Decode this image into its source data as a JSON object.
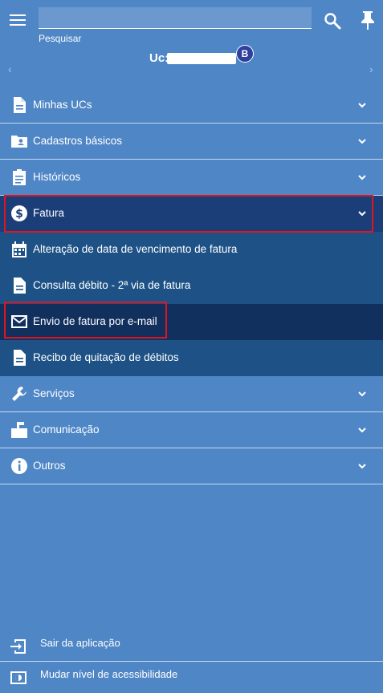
{
  "header": {
    "search_value": "",
    "search_label": "Pesquisar",
    "uc_label": "Uc:",
    "uc_badge": "B",
    "prev_arrow": "‹",
    "next_arrow": "›",
    "icons": [
      "menu-icon",
      "search-icon",
      "pin-icon"
    ]
  },
  "menu": {
    "items": [
      {
        "label": "Minhas UCs",
        "icon": "document-icon"
      },
      {
        "label": "Cadastros básicos",
        "icon": "folder-user-icon"
      },
      {
        "label": "Históricos",
        "icon": "clipboard-icon"
      },
      {
        "label": "Fatura",
        "icon": "dollar-circle-icon",
        "expanded": true
      },
      {
        "label": "Serviços",
        "icon": "wrench-icon"
      },
      {
        "label": "Comunicação",
        "icon": "mailbox-icon"
      },
      {
        "label": "Outros",
        "icon": "info-icon"
      }
    ],
    "fatura_sub": [
      {
        "label": "Alteração de data de vencimento de fatura",
        "icon": "calendar-icon"
      },
      {
        "label": "Consulta débito - 2ª via de fatura",
        "icon": "document-icon"
      },
      {
        "label": "Envio de fatura por e-mail",
        "icon": "mail-icon",
        "selected": true
      },
      {
        "label": "Recibo de quitação de débitos",
        "icon": "document-icon"
      }
    ]
  },
  "footer": {
    "logout_label": "Sair da aplicação",
    "accessibility_label": "Mudar nível de acessibilidade"
  },
  "colors": {
    "background": "#4f86c6",
    "active_header": "#1b3d78",
    "submenu": "#1e5286",
    "selected_sub": "#11305e",
    "highlight": "#e0161e",
    "badge": "#2f3f9e"
  }
}
